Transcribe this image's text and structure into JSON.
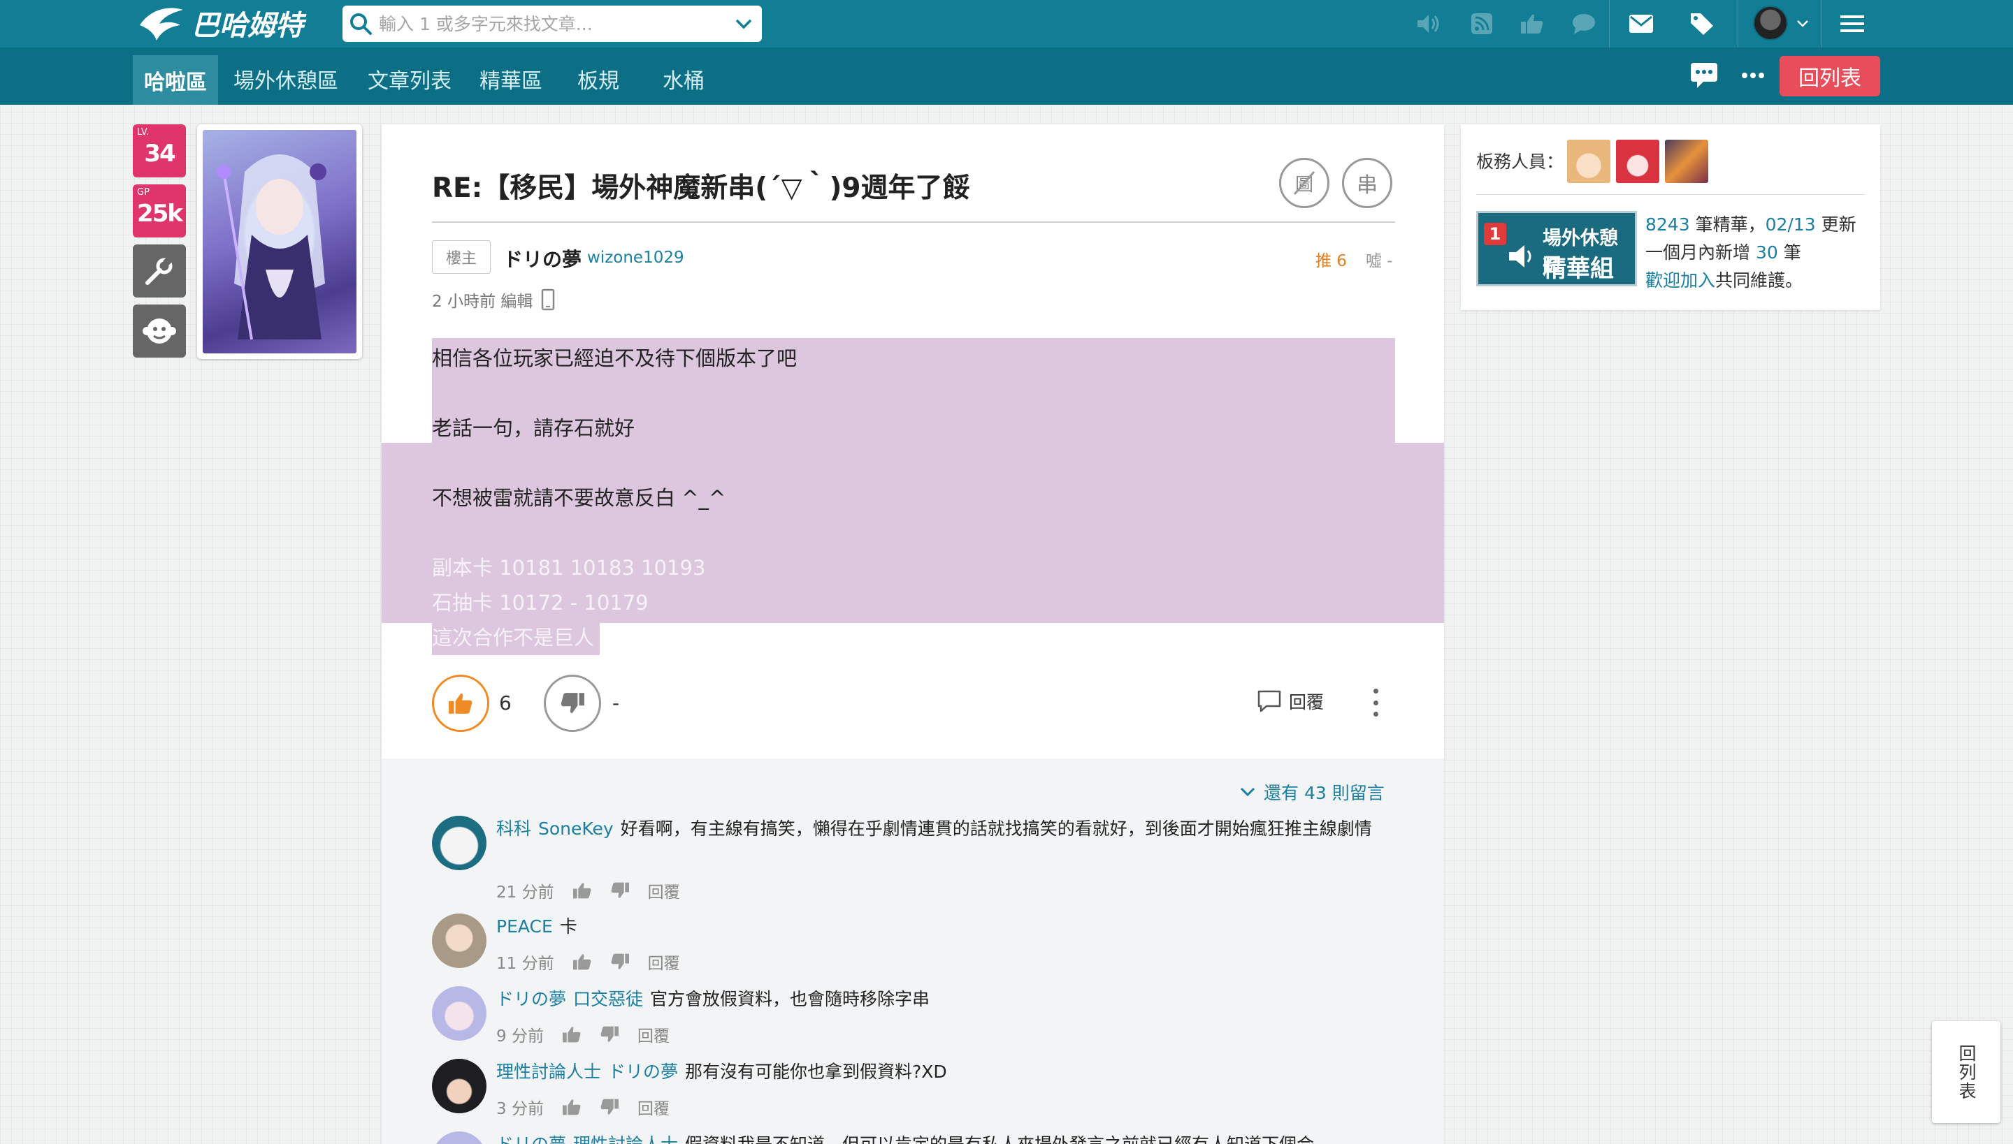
{
  "header": {
    "logo_text": "巴哈姆特",
    "search_placeholder": "輸入 1 或多字元來找文章...",
    "colors": {
      "topbar": "#117e96",
      "subnav": "#0d6f85",
      "accent": "#e84d5b"
    }
  },
  "subnav": {
    "tabs": [
      {
        "label": "哈啦區",
        "active": true
      },
      {
        "label": "場外休憩區"
      },
      {
        "label": "文章列表"
      },
      {
        "label": "精華區"
      },
      {
        "label": "板規"
      },
      {
        "label": "水桶"
      }
    ],
    "return_label": "回列表"
  },
  "left": {
    "level_label": "LV.",
    "level": "34",
    "gp_label": "GP",
    "gp": "25k"
  },
  "post": {
    "title": "RE:【移民】場外神魔新串(´▽｀)9週年了餒",
    "btn_thread": "串",
    "btn_pic": "圖",
    "owner_tag": "樓主",
    "author_name": "ドリの夢",
    "author_id": "wizone1029",
    "gp": "推 6",
    "bp": "噓 -",
    "time": "2 小時前 編輯",
    "lines": [
      "相信各位玩家已經迫不及待下個版本了吧",
      "老話一句，請存石就好",
      "不想被雷就請不要故意反白 ^_^",
      "副本卡 10181 10183 10193",
      "石抽卡 10172 - 10179",
      "這次合作不是巨人"
    ],
    "like_count": "6",
    "dislike_count": "-",
    "reply_label": "回覆"
  },
  "comments": {
    "more_label": "還有 43 則留言",
    "reply_label": "回覆",
    "items": [
      {
        "user": "科科",
        "mention": "SoneKey",
        "text": "好看啊，有主線有搞笑，懶得在乎劇情連貫的話就找搞笑的看就好，到後面才開始瘋狂推主線劇情",
        "time": "21 分前"
      },
      {
        "user": "PEACE",
        "mention": "",
        "text": "卡",
        "time": "11 分前"
      },
      {
        "user": "ドリの夢",
        "mention": "口交惡徒",
        "text": "官方會放假資料，也會隨時移除字串",
        "time": "9 分前"
      },
      {
        "user": "理性討論人士",
        "mention": "ドリの夢",
        "text": "那有沒有可能你也拿到假資料?XD",
        "time": "3 分前"
      },
      {
        "user": "ドリの夢",
        "mention": "理性討論人士",
        "text": "假資料我是不知道，但可以肯定的是有私人來場外發言之前就已經有人知道下個合",
        "time": ""
      }
    ]
  },
  "sidebar": {
    "mods_label": "板務人員：",
    "feature_number": "1",
    "feature_title1": "場外休憩區",
    "feature_title2": "精華組",
    "count": "8243",
    "count_suffix": " 筆精華，",
    "date": "02/13",
    "date_suffix": " 更新",
    "month_prefix": "一個月內新增 ",
    "month_count": "30",
    "month_suffix": " 筆",
    "join_link": "歡迎加入",
    "join_suffix": "共同維護。"
  },
  "float_button": "回列表"
}
